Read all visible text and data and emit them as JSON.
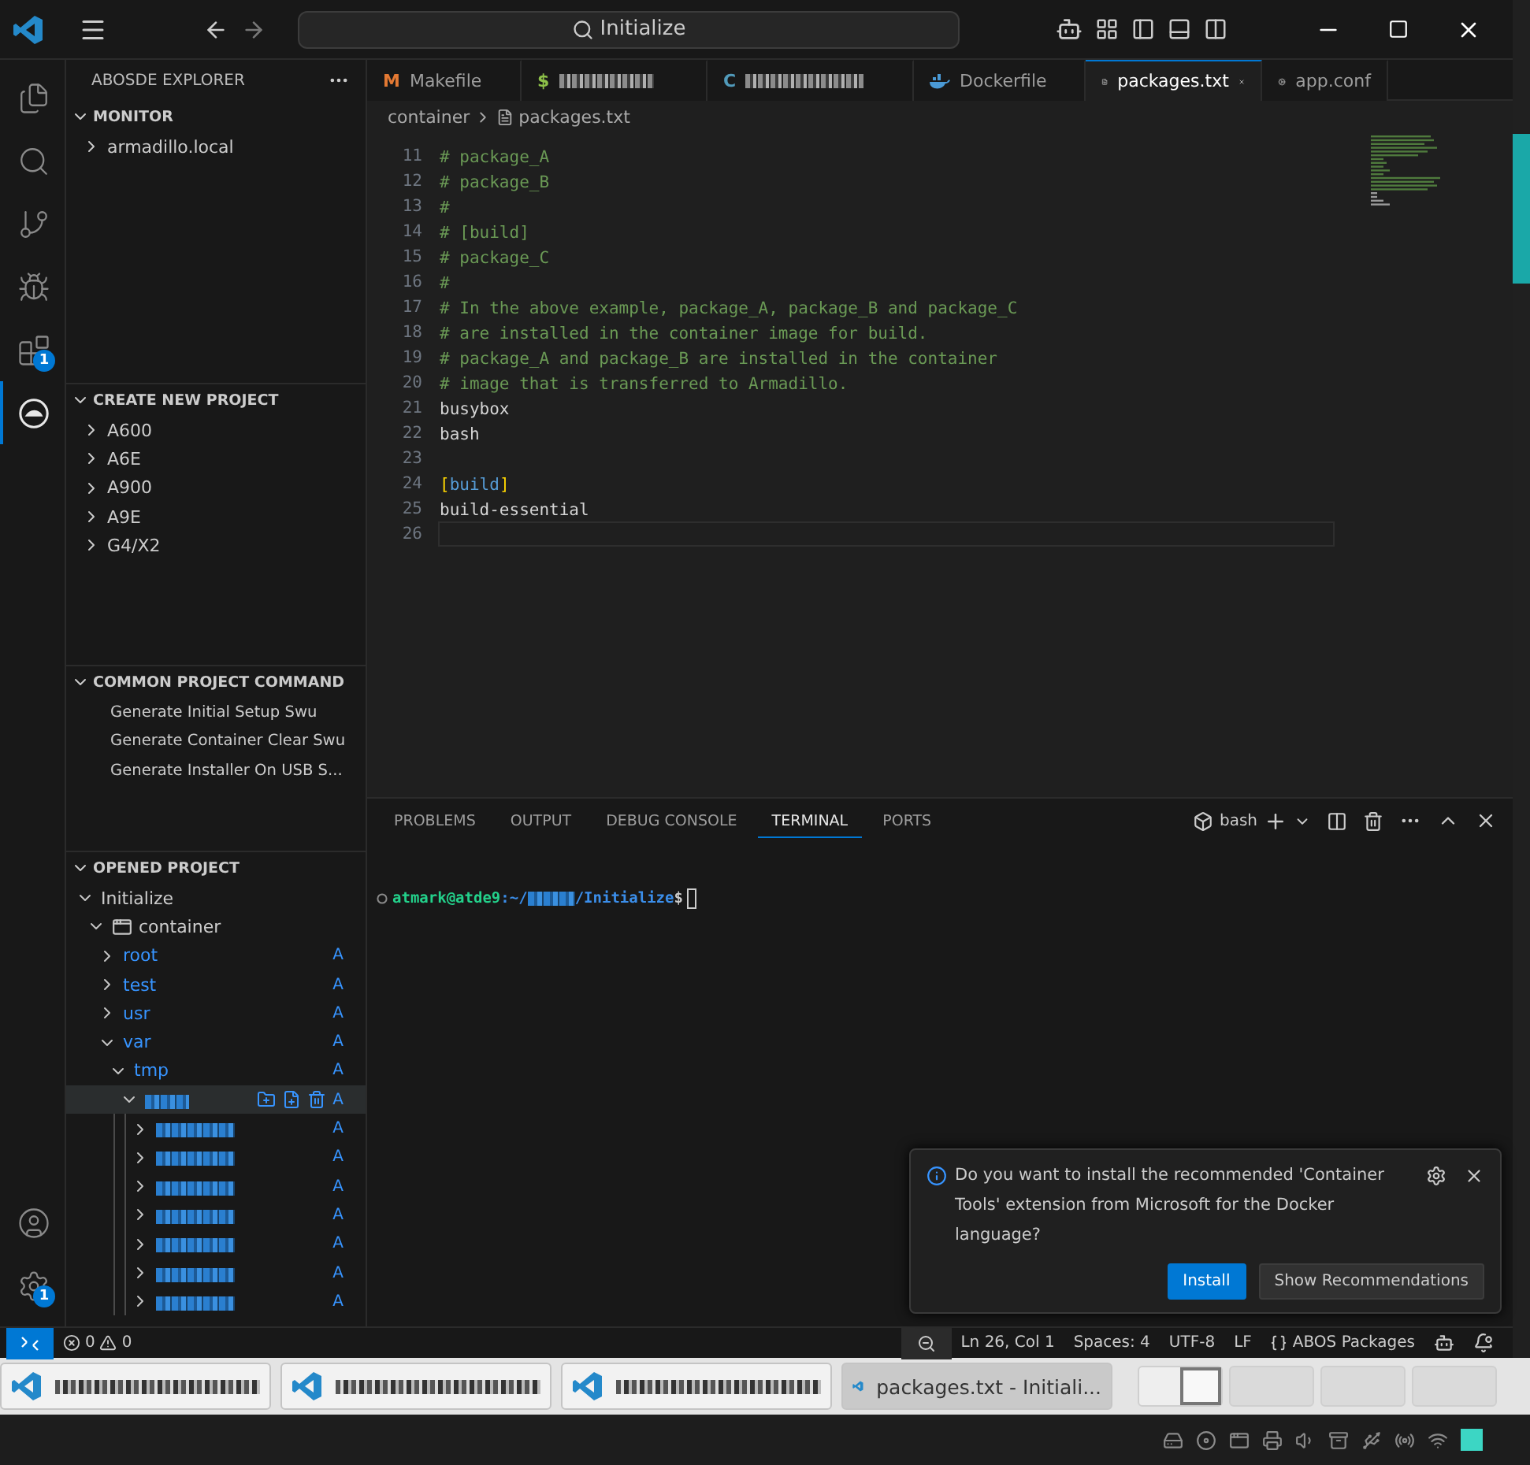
{
  "title_bar": {
    "search": "Initialize"
  },
  "activity_bar": {
    "top": [
      {
        "kind": "explorer",
        "selected": false
      },
      {
        "kind": "search",
        "selected": false
      },
      {
        "kind": "source-control",
        "selected": false
      },
      {
        "kind": "run-debug",
        "selected": false
      },
      {
        "kind": "extensions",
        "selected": false,
        "badge": "1"
      },
      {
        "kind": "abos",
        "selected": true
      }
    ],
    "bottom": [
      {
        "kind": "accounts",
        "selected": false
      },
      {
        "kind": "manage",
        "selected": false,
        "badge": "1"
      }
    ]
  },
  "sidebar": {
    "title": "ABOSDE EXPLORER",
    "sections": [
      {
        "title": "MONITOR",
        "expanded": true,
        "items": [
          {
            "label": "armadillo.local",
            "expanded": false
          }
        ]
      },
      {
        "title": "CREATE NEW PROJECT",
        "expanded": true,
        "items": [
          {
            "label": "A600",
            "expanded": false
          },
          {
            "label": "A6E",
            "expanded": false
          },
          {
            "label": "A900",
            "expanded": false
          },
          {
            "label": "A9E",
            "expanded": false
          },
          {
            "label": "G4/X2",
            "expanded": false
          }
        ]
      },
      {
        "title": "COMMON PROJECT COMMAND",
        "expanded": true,
        "commands": [
          "Generate Initial Setup Swu",
          "Generate Container Clear Swu",
          "Generate Installer On USB S..."
        ]
      },
      {
        "title": "OPENED PROJECT",
        "expanded": true,
        "tree": [
          {
            "label": "Initialize",
            "expanded": true,
            "children": [
              {
                "label": "container",
                "kind": "container",
                "expanded": true,
                "children": [
                  {
                    "label": "root",
                    "expanded": false,
                    "badge": "A"
                  },
                  {
                    "label": "test",
                    "expanded": false,
                    "badge": "A"
                  },
                  {
                    "label": "usr",
                    "expanded": false,
                    "badge": "A"
                  },
                  {
                    "label": "var",
                    "expanded": true,
                    "badge": "A",
                    "children": [
                      {
                        "label": "tmp",
                        "expanded": true,
                        "badge": "A",
                        "children": [
                          {
                            "kind": "redacted",
                            "expanded": true,
                            "hovered": true,
                            "badge": "A",
                            "children": [
                              {
                                "kind": "redacted",
                                "expanded": false,
                                "badge": "A"
                              },
                              {
                                "kind": "redacted",
                                "expanded": false,
                                "badge": "A"
                              },
                              {
                                "kind": "redacted",
                                "expanded": false,
                                "badge": "A"
                              },
                              {
                                "kind": "redacted",
                                "expanded": false,
                                "badge": "A"
                              },
                              {
                                "kind": "redacted",
                                "expanded": false,
                                "badge": "A"
                              },
                              {
                                "kind": "redacted",
                                "expanded": false,
                                "badge": "A"
                              },
                              {
                                "kind": "redacted",
                                "expanded": false,
                                "badge": "A"
                              }
                            ]
                          }
                        ]
                      }
                    ]
                  }
                ]
              }
            ]
          }
        ]
      }
    ]
  },
  "tabs": [
    {
      "label": "Makefile",
      "kind": "makefile",
      "glyph": "M",
      "selected": false
    },
    {
      "kind": "shell",
      "glyph": "$",
      "selected": false
    },
    {
      "kind": "c",
      "glyph": "C",
      "selected": false
    },
    {
      "label": "Dockerfile",
      "kind": "docker",
      "selected": false
    },
    {
      "label": "packages.txt",
      "kind": "text",
      "selected": true
    },
    {
      "label": "app.conf",
      "kind": "config",
      "selected": false
    }
  ],
  "breadcrumb": [
    "container",
    "packages.txt"
  ],
  "editor": {
    "lines": [
      {
        "number": "11",
        "tokens": [
          {
            "kind": "comment",
            "text": "# package_A"
          }
        ]
      },
      {
        "number": "12",
        "tokens": [
          {
            "kind": "comment",
            "text": "# package_B"
          }
        ]
      },
      {
        "number": "13",
        "tokens": [
          {
            "kind": "comment",
            "text": "#"
          }
        ]
      },
      {
        "number": "14",
        "tokens": [
          {
            "kind": "comment",
            "text": "# [build]"
          }
        ]
      },
      {
        "number": "15",
        "tokens": [
          {
            "kind": "comment",
            "text": "# package_C"
          }
        ]
      },
      {
        "number": "16",
        "tokens": [
          {
            "kind": "comment",
            "text": "#"
          }
        ]
      },
      {
        "number": "17",
        "tokens": [
          {
            "kind": "comment",
            "text": "# In the above example, package_A, package_B and package_C"
          }
        ]
      },
      {
        "number": "18",
        "tokens": [
          {
            "kind": "comment",
            "text": "# are installed in the container image for build."
          }
        ]
      },
      {
        "number": "19",
        "tokens": [
          {
            "kind": "comment",
            "text": "# package_A and package_B are installed in the container"
          }
        ]
      },
      {
        "number": "20",
        "tokens": [
          {
            "kind": "comment",
            "text": "# image that is transferred to Armadillo."
          }
        ]
      },
      {
        "number": "21",
        "tokens": [
          {
            "kind": "plain",
            "text": "busybox"
          }
        ]
      },
      {
        "number": "22",
        "tokens": [
          {
            "kind": "plain",
            "text": "bash"
          }
        ]
      },
      {
        "number": "23"
      },
      {
        "number": "24",
        "tokens": [
          {
            "kind": "bracket",
            "text": "["
          },
          {
            "kind": "section",
            "text": "build"
          },
          {
            "kind": "bracket",
            "text": "]"
          }
        ]
      },
      {
        "number": "25",
        "tokens": [
          {
            "kind": "plain",
            "text": "build-essential"
          }
        ]
      },
      {
        "number": "26",
        "selected": true
      }
    ]
  },
  "panel": {
    "tabs": [
      {
        "label": "PROBLEMS",
        "selected": false
      },
      {
        "label": "OUTPUT",
        "selected": false
      },
      {
        "label": "DEBUG CONSOLE",
        "selected": false
      },
      {
        "label": "TERMINAL",
        "selected": true
      },
      {
        "label": "PORTS",
        "selected": false
      }
    ],
    "profile": "bash",
    "prompt": {
      "user": "atmark@atde9",
      "path_start": ":~/",
      "path_end": "/Initialize",
      "symbol": "$"
    }
  },
  "notification": {
    "message": "Do you want to install the recommended 'Container Tools' extension from Microsoft for the Docker language?",
    "buttons": [
      {
        "label": "Install",
        "primary": true
      },
      {
        "label": "Show Recommendations",
        "primary": false
      }
    ]
  },
  "status_bar": {
    "errors": "0",
    "warnings": "0",
    "items": [
      {
        "kind": "zoom"
      },
      {
        "kind": "text",
        "label": "Ln 26, Col 1"
      },
      {
        "kind": "text",
        "label": "Spaces: 4"
      },
      {
        "kind": "text",
        "label": "UTF-8"
      },
      {
        "kind": "text",
        "label": "LF"
      },
      {
        "kind": "language",
        "label": "ABOS Packages"
      },
      {
        "kind": "copilot"
      },
      {
        "kind": "bell"
      }
    ]
  },
  "taskbar": {
    "windows": [
      {
        "selected": false
      },
      {
        "selected": false
      },
      {
        "selected": false
      },
      {
        "label": "packages.txt - Initiali...",
        "selected": true
      }
    ],
    "desktops": [
      {
        "selected": true
      },
      {
        "selected": false
      },
      {
        "selected": false
      },
      {
        "selected": false
      }
    ]
  }
}
